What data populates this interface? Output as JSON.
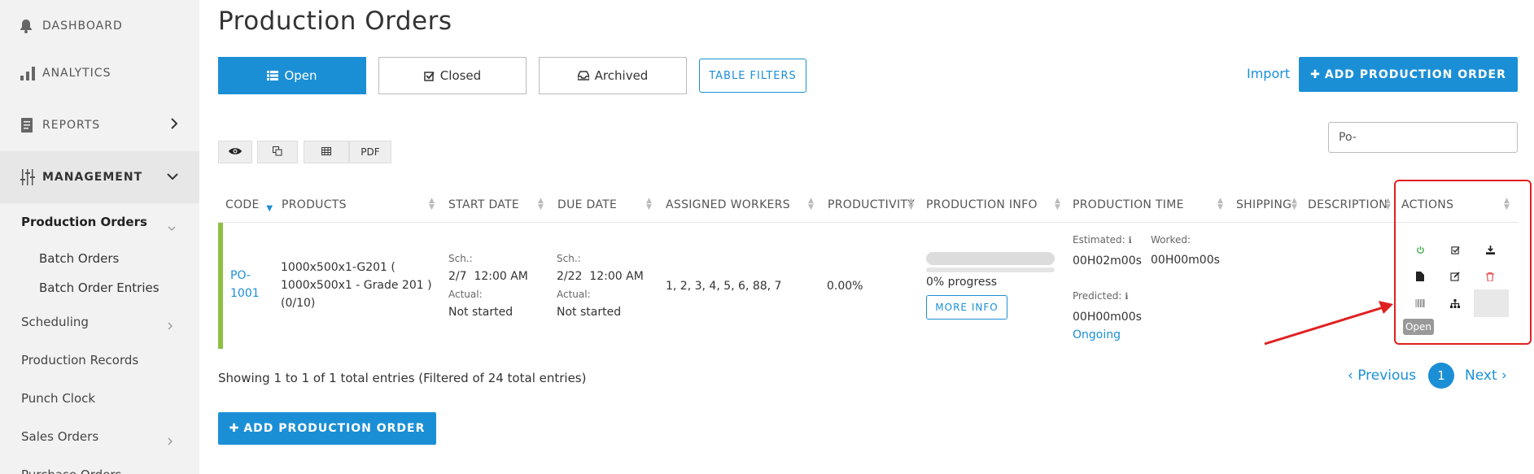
{
  "sidebar": {
    "dashboard": "DASHBOARD",
    "analytics": "ANALYTICS",
    "reports": "REPORTS",
    "management": "MANAGEMENT",
    "production_orders": "Production Orders",
    "batch_orders": "Batch Orders",
    "batch_order_entries": "Batch Order Entries",
    "scheduling": "Scheduling",
    "production_records": "Production Records",
    "punch_clock": "Punch Clock",
    "sales_orders": "Sales Orders",
    "purchase_orders": "Purchase Orders"
  },
  "page": {
    "title": "Production Orders"
  },
  "tabs": {
    "open": "Open",
    "closed": "Closed",
    "archived": "Archived"
  },
  "toolbar": {
    "table_filters": "TABLE FILTERS",
    "import": "Import",
    "add_top": "ADD PRODUCTION ORDER",
    "pdf": "PDF",
    "search_value": "Po-"
  },
  "table": {
    "headers": {
      "code": "CODE",
      "products": "PRODUCTS",
      "start_date": "START DATE",
      "due_date": "DUE DATE",
      "workers": "ASSIGNED WORKERS",
      "productivity": "PRODUCTIVITY",
      "production_info": "PRODUCTION INFO",
      "production_time": "PRODUCTION TIME",
      "shipping": "SHIPPING",
      "description": "DESCRIPTION",
      "actions": "ACTIONS"
    },
    "row": {
      "code_line1": "PO-",
      "code_line2": "1001",
      "product_line1": "1000x500x1-G201 (",
      "product_line2": "1000x500x1 - Grade 201 )",
      "product_line3": "(0/10)",
      "sch_label": "Sch.:",
      "actual_label": "Actual:",
      "start_date": "2/7",
      "start_time": "12:00 AM",
      "start_actual": "Not started",
      "due_date": "2/22",
      "due_time": "12:00 AM",
      "due_actual": "Not started",
      "workers": "1, 2, 3, 4, 5, 6, 88, 7",
      "productivity": "0.00%",
      "progress_fraction": 0,
      "progress_text": "0% progress",
      "more_info": "MORE INFO",
      "estimated_label": "Estimated:",
      "estimated_value": "00H02m00s",
      "worked_label": "Worked:",
      "worked_value": "00H00m00s",
      "predicted_label": "Predicted:",
      "predicted_value": "00H00m00s",
      "status": "Ongoing"
    }
  },
  "tooltip": "Open",
  "footer": {
    "showing_prefix": "Showing ",
    "from": "1",
    "to_word": " to ",
    "to": "1",
    "of_word": " of ",
    "total": "1",
    "showing_suffix": " total entries (Filtered of 24 total entries)",
    "previous": "Previous",
    "page": "1",
    "next": "Next",
    "add_bottom": "ADD PRODUCTION ORDER"
  },
  "colors": {
    "accent": "#1b8fd6",
    "row_status": "#8dc044",
    "highlight": "#e02020"
  }
}
